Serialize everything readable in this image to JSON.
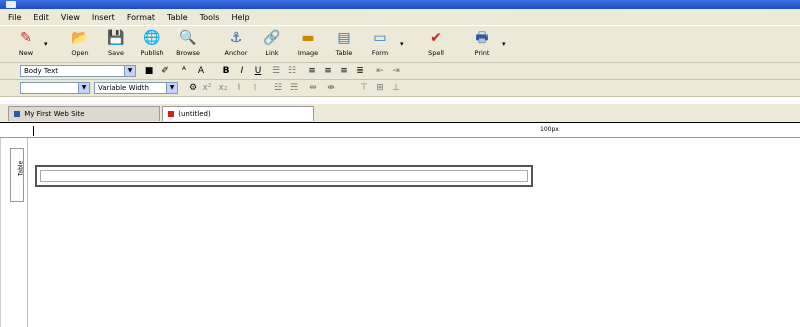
{
  "menubar": {
    "items": [
      "File",
      "Edit",
      "View",
      "Insert",
      "Format",
      "Table",
      "Tools",
      "Help"
    ]
  },
  "toolbar": {
    "buttons": [
      {
        "label": "New",
        "icon": "pen-icon"
      },
      {
        "label": "Open",
        "icon": "folder-open-icon"
      },
      {
        "label": "Save",
        "icon": "floppy-disk-icon"
      },
      {
        "label": "Publish",
        "icon": "globe-icon"
      },
      {
        "label": "Browse",
        "icon": "magnifier-icon"
      },
      {
        "label": "Anchor",
        "icon": "anchor-icon"
      },
      {
        "label": "Link",
        "icon": "chain-link-icon"
      },
      {
        "label": "Image",
        "icon": "image-icon"
      },
      {
        "label": "Table",
        "icon": "table-icon"
      },
      {
        "label": "Form",
        "icon": "form-icon"
      },
      {
        "label": "Spell",
        "icon": "spell-check-icon"
      },
      {
        "label": "Print",
        "icon": "printer-icon"
      }
    ]
  },
  "format_bar1": {
    "paragraph_style": "Body Text",
    "bold": "B",
    "italic": "I",
    "underline": "U"
  },
  "format_bar2": {
    "font_select": "",
    "font_width": "Variable Width"
  },
  "tabs": [
    {
      "label": "My First Web Site"
    },
    {
      "label": "(untitled)"
    }
  ],
  "ruler": {
    "width_label": "100px"
  },
  "left_ruler": {
    "label": "Table"
  },
  "colors": {
    "chrome": "#ece9d8",
    "titlebar": "#1d4cc4",
    "tab_active": "#ffffff"
  }
}
